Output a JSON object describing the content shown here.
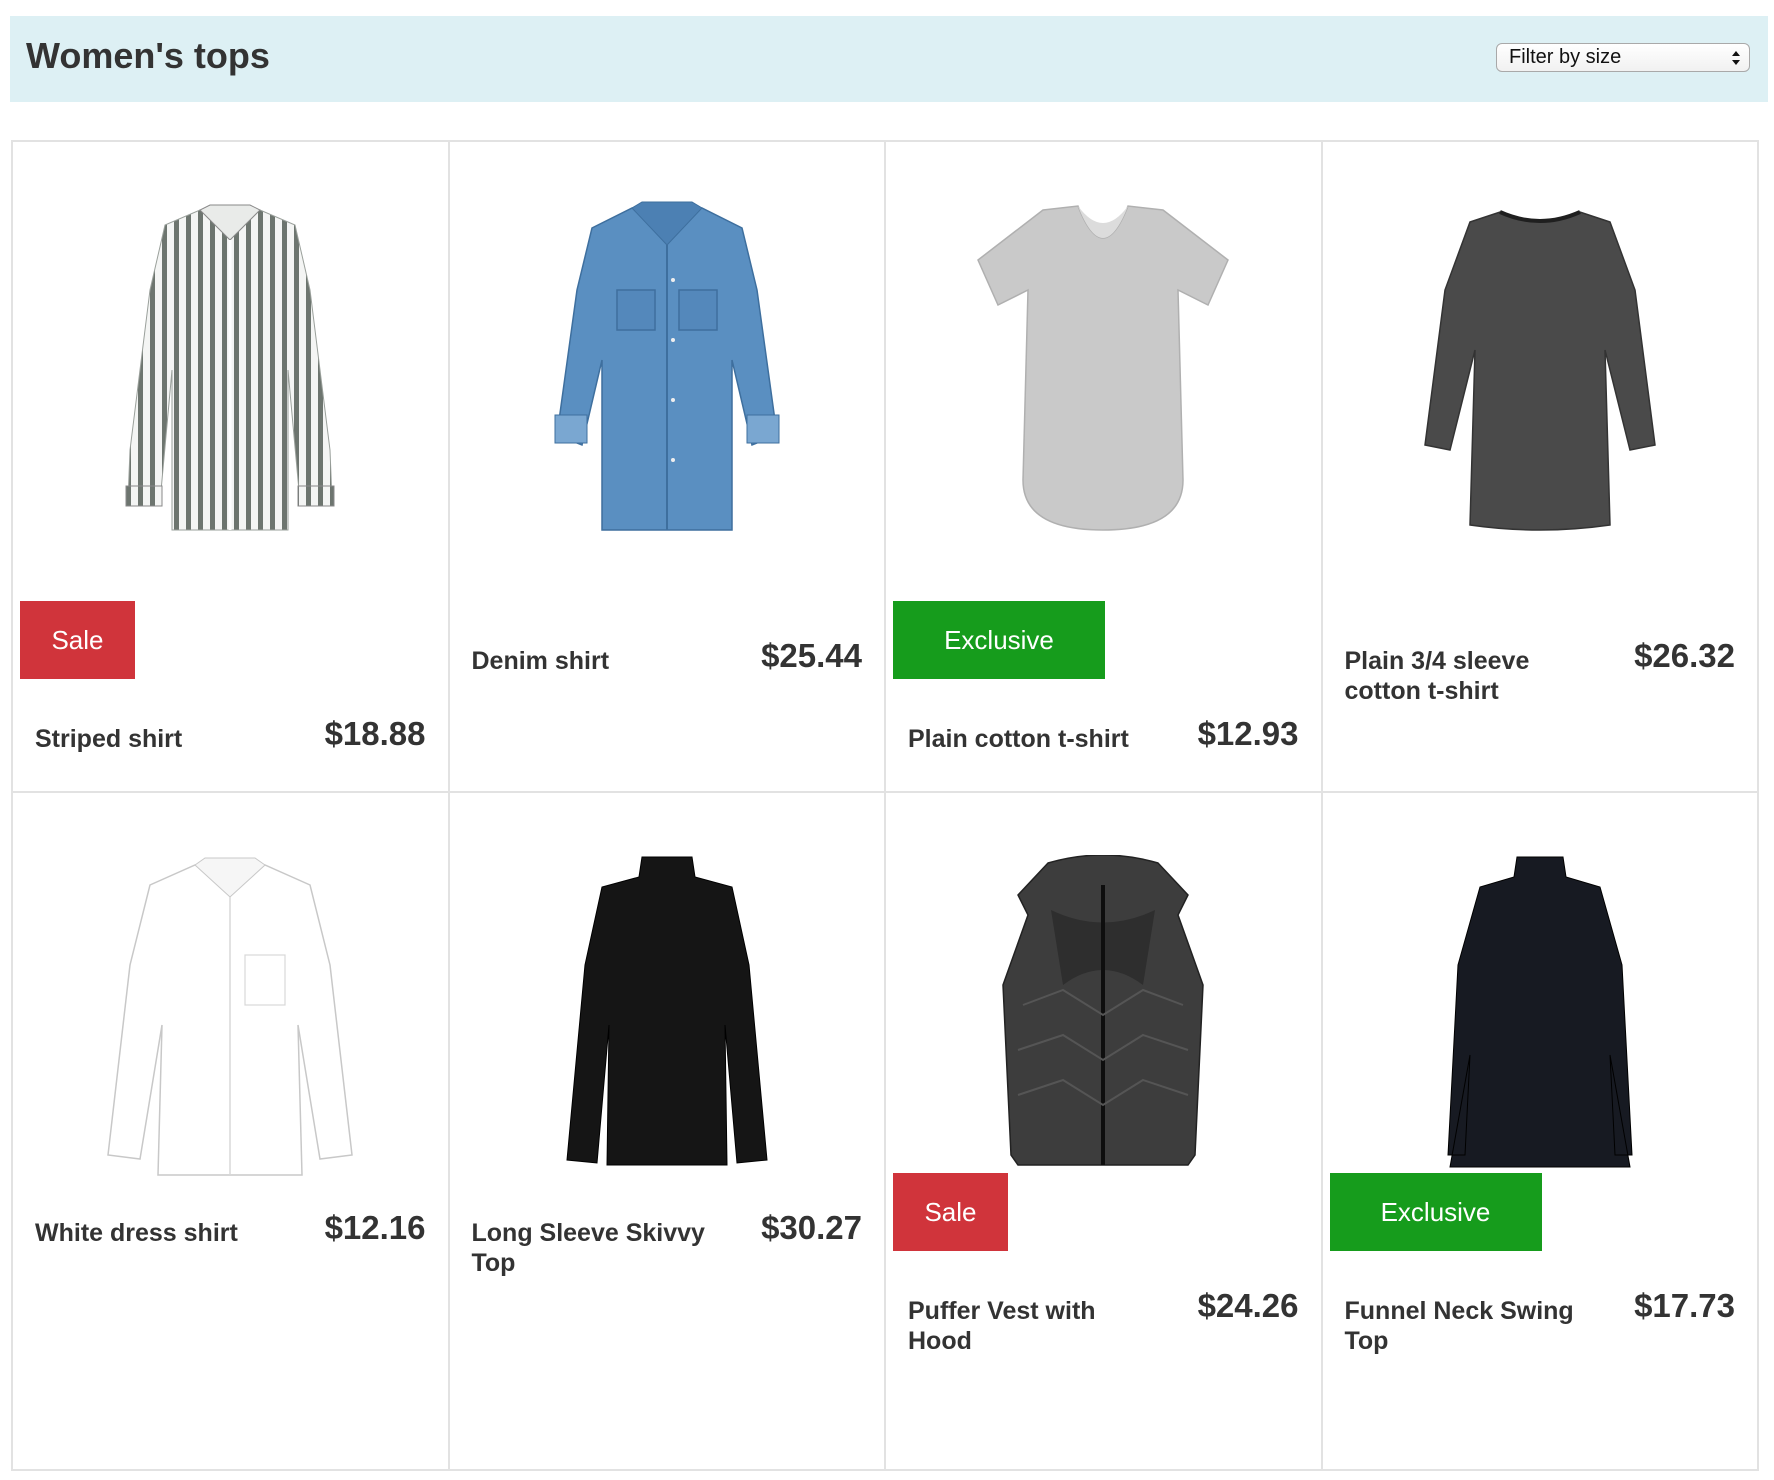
{
  "page": {
    "title": "Women's tops",
    "filter": {
      "label": "Filter by size"
    }
  },
  "products": [
    {
      "name": "Striped shirt",
      "price": "$18.88",
      "badge": "Sale"
    },
    {
      "name": "Denim shirt",
      "price": "$25.44",
      "badge": ""
    },
    {
      "name": "Plain cotton t-shirt",
      "price": "$12.93",
      "badge": "Exclusive"
    },
    {
      "name": "Plain 3/4 sleeve cotton t-shirt",
      "price": "$26.32",
      "badge": ""
    },
    {
      "name": "White dress shirt",
      "price": "$12.16",
      "badge": ""
    },
    {
      "name": "Long Sleeve Skivvy Top",
      "price": "$30.27",
      "badge": ""
    },
    {
      "name": "Puffer Vest with Hood",
      "price": "$24.26",
      "badge": "Sale"
    },
    {
      "name": "Funnel Neck Swing Top",
      "price": "$17.73",
      "badge": "Exclusive"
    }
  ],
  "colors": {
    "header_bg": "#ddf0f4",
    "sale_badge": "#d0343b",
    "exclusive_badge": "#169c1c",
    "text": "#333333",
    "border": "#e2e2e2"
  }
}
